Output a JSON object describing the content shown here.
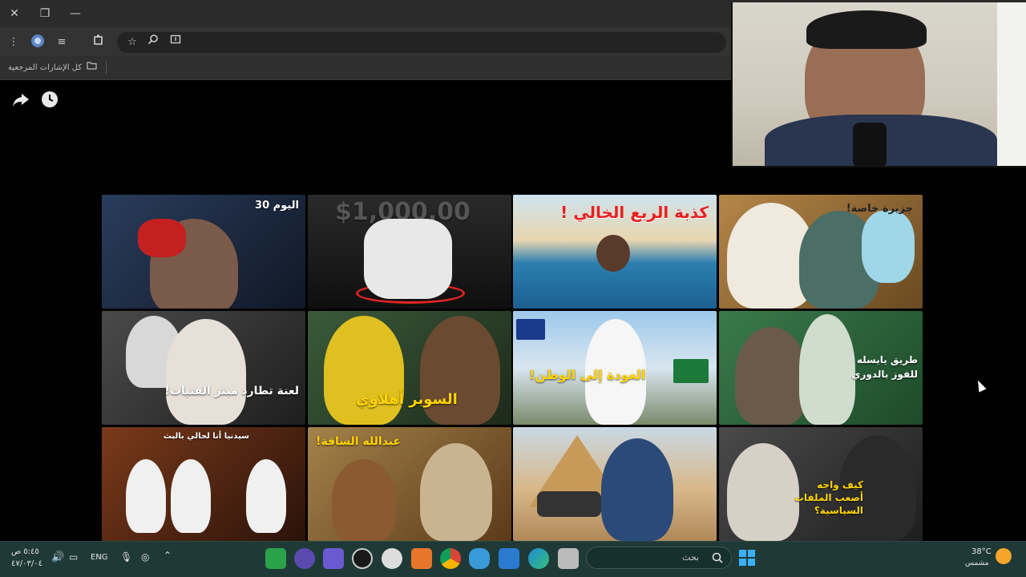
{
  "window": {
    "close_glyph": "✕",
    "restore_glyph": "❐",
    "minimize_glyph": "—"
  },
  "bookmarks": {
    "all_bookmarks_label": "كل الإشارات المرجعية"
  },
  "page": {
    "share_icon": "share-icon",
    "watch_later_icon": "clock-icon"
  },
  "thumbnails": [
    {
      "caption": "اليوم 30",
      "bg": "#1d2a44",
      "accent": "#c62020"
    },
    {
      "caption": "$1,000,00",
      "bg": "#151515",
      "accent": "#e02424"
    },
    {
      "caption": "كذبة الربع الخالي !",
      "bg": "#3c9ac8",
      "accent": "#ff2a2a"
    },
    {
      "caption": "جزيرة خاصة!",
      "bg": "#a57a3a",
      "accent": "#ffffff"
    },
    {
      "caption": "لعنة تطارد مبتز الفتيات!",
      "bg": "#3a3a3a",
      "accent": "#ff3030"
    },
    {
      "caption": "السوبر أهلاوي",
      "bg": "#2d4d2a",
      "accent": "#ffd400"
    },
    {
      "caption": "العودة إلى الوطن!",
      "bg": "#7fb2d9",
      "accent": "#ffd400"
    },
    {
      "caption": "طريق يايسله للفوز بالدوري",
      "bg": "#2e6a3a",
      "accent": "#ffffff"
    },
    {
      "caption": "سيدنيا أنا لحالي بالبث",
      "bg": "#5a2a1a",
      "accent": "#ffffff"
    },
    {
      "caption": "عبدالله الساقة!",
      "bg": "#8a6a3a",
      "accent": "#ffd400"
    },
    {
      "caption": "",
      "bg": "#c9a06a",
      "accent": "#ffffff"
    },
    {
      "caption": "كيف واجه أصعب الملفات السياسية؟",
      "bg": "#3a3a3a",
      "accent": "#ffd400"
    }
  ],
  "taskbar": {
    "time": "٥:٤٥ ص",
    "date": "٤٧/٠٣/٠٤",
    "language": "ENG",
    "search_placeholder": "بحث",
    "temperature": "38°C",
    "weather": "مشمس"
  },
  "colors": {
    "taskbar_bg": "#1f3a36",
    "chrome_bg": "#2b2b2b"
  }
}
